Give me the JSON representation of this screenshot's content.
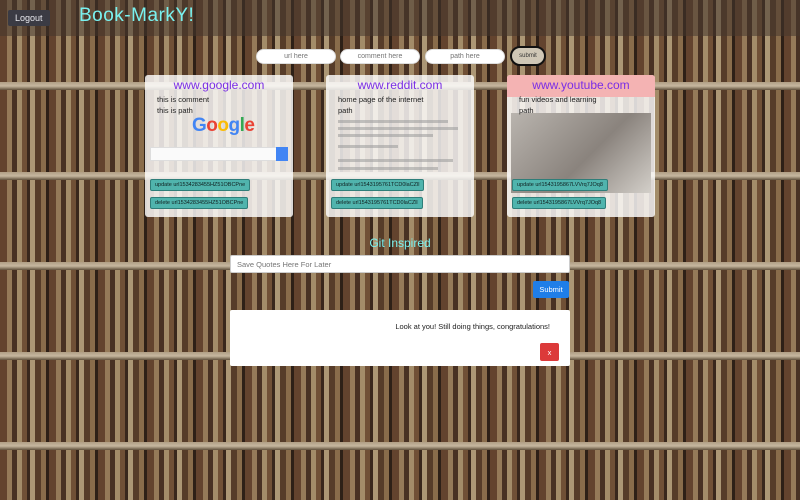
{
  "header": {
    "logout_label": "Logout",
    "brand": "Book-MarkY!"
  },
  "form": {
    "url_placeholder": "url here",
    "comment_placeholder": "comment here",
    "path_placeholder": "path here",
    "submit_label": "submit"
  },
  "bookmarks": [
    {
      "site": "www.google.com",
      "comment": "this is comment",
      "path": "this is path",
      "update_label": "update url1534283455HZ51OBCPne",
      "delete_label": "delete url1534283455HZ51OBCPne"
    },
    {
      "site": "www.reddit.com",
      "comment": "home page of the internet",
      "path": "path",
      "update_label": "update url1543195761TCD0laCZll",
      "delete_label": "delete url1543195761TCD0laCZll"
    },
    {
      "site": "www.youtube.com",
      "comment": "fun videos and learning",
      "path": "path",
      "update_label": "update url1543195867LVVrq7JOq8",
      "delete_label": "delete url1543195867LVVrq7JOq8"
    }
  ],
  "quotes": {
    "heading": "Git Inspired",
    "input_placeholder": "Save Quotes Here For Later",
    "submit_label": "Submit"
  },
  "message": {
    "text": "Look at you! Still doing things, congratulations!",
    "close_label": "x"
  },
  "preview": {
    "google_logo": "Google"
  },
  "colors": {
    "brand": "#79f2f0",
    "site_link": "#7a2ee6",
    "card_button": "#50b4ad",
    "primary_button": "#1f7ee8",
    "close_button": "#dc3a3a"
  }
}
